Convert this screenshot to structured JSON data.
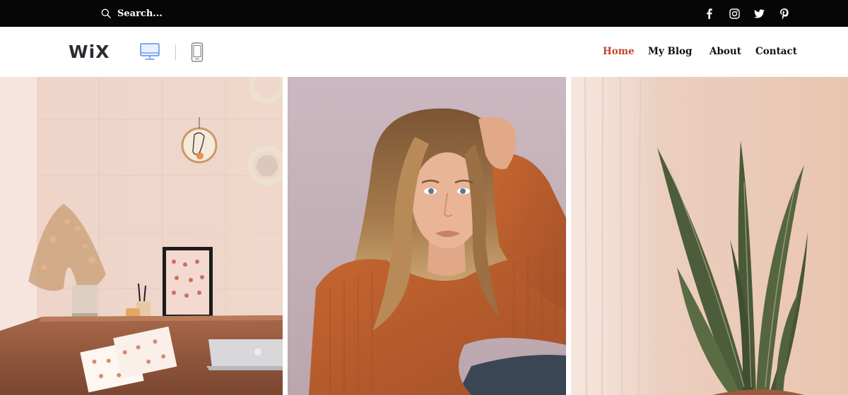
{
  "topbar": {
    "search_placeholder": "Search...",
    "social": [
      "facebook-icon",
      "instagram-icon",
      "twitter-icon",
      "pinterest-icon"
    ]
  },
  "header": {
    "logo": "WiX",
    "device_toggle": {
      "selected": "desktop",
      "options": [
        "desktop-icon",
        "mobile-icon"
      ]
    },
    "nav": [
      {
        "label": "Home",
        "active": true
      },
      {
        "label": "My Blog",
        "active": false
      },
      {
        "label": "About",
        "active": false
      },
      {
        "label": "Contact",
        "active": false
      }
    ]
  },
  "colors": {
    "topbar_bg": "#060606",
    "accent": "#c0452a",
    "nav_text": "#111111",
    "device_selected": "#5b8def",
    "device_unselected": "#888888"
  },
  "gallery": [
    {
      "subject": "workspace-desk-photo"
    },
    {
      "subject": "woman-portrait-photo"
    },
    {
      "subject": "snake-plant-photo"
    }
  ]
}
